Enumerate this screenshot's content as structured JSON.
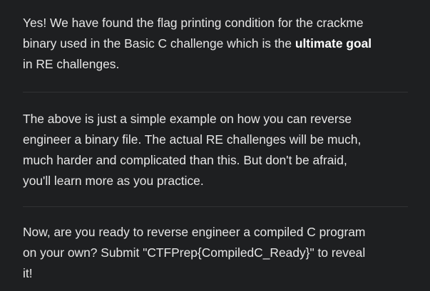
{
  "paragraphs": {
    "p1": {
      "line1": "Yes! We have found the flag printing condition for the crackme",
      "line2_before": "binary used in the Basic C challenge which is the ",
      "line2_strong": "ultimate goal",
      "line3": "in RE challenges."
    },
    "p2": {
      "line1": "The above is just a simple example on how you can reverse",
      "line2": "engineer a binary file. The actual RE challenges will be much,",
      "line3": "much harder and complicated than this. But don't be afraid,",
      "line4": "you'll learn more as you practice."
    },
    "p3": {
      "line1": "Now, are you ready to reverse engineer a compiled C program",
      "line2": "on your own? Submit \"CTFPrep{CompiledC_Ready}\" to reveal",
      "line3": "it!"
    }
  },
  "colors": {
    "background": "#1e1f21",
    "text": "#e6e6e6",
    "divider": "#303134"
  }
}
